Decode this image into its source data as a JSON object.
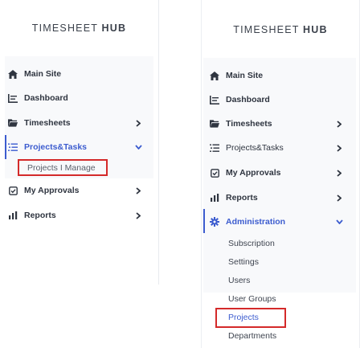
{
  "left": {
    "brand": {
      "light": "TIMESHEET",
      "bold": "HUB"
    },
    "items": [
      {
        "label": "Main Site",
        "icon": "home-icon"
      },
      {
        "label": "Dashboard",
        "icon": "dashboard-icon"
      },
      {
        "label": "Timesheets",
        "icon": "folder-icon"
      },
      {
        "label": "Projects&Tasks",
        "icon": "tasks-list-icon"
      },
      {
        "label": "My Approvals",
        "icon": "checkbox-icon"
      },
      {
        "label": "Reports",
        "icon": "bar-chart-icon"
      }
    ],
    "subitem": "Projects I Manage"
  },
  "right": {
    "brand": {
      "light": "TIMESHEET",
      "bold": "HUB"
    },
    "items": [
      {
        "label": "Main Site",
        "icon": "home-icon"
      },
      {
        "label": "Dashboard",
        "icon": "dashboard-icon"
      },
      {
        "label": "Timesheets",
        "icon": "folder-icon"
      },
      {
        "label": "Projects&Tasks",
        "icon": "tasks-list-icon"
      },
      {
        "label": "My Approvals",
        "icon": "checkbox-icon"
      },
      {
        "label": "Reports",
        "icon": "bar-chart-icon"
      },
      {
        "label": "Administration",
        "icon": "gear-icon"
      }
    ],
    "subitems": [
      "Subscription",
      "Settings",
      "Users",
      "User Groups",
      "Projects",
      "Departments"
    ]
  },
  "colors": {
    "accent": "#3c5ccf",
    "highlight": "#d42a2a",
    "text": "#2f3540"
  }
}
